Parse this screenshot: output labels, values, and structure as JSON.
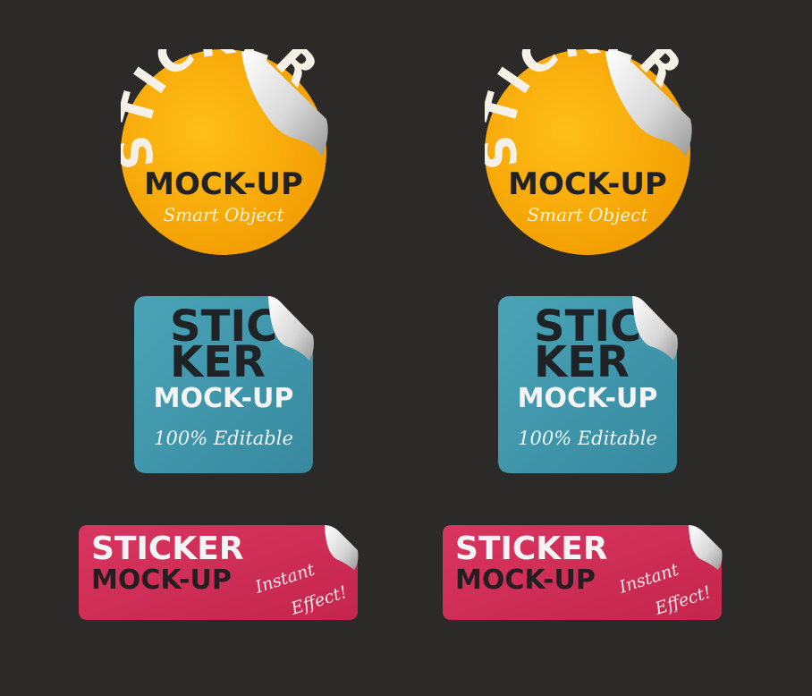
{
  "background": "#2b2a29",
  "colors": {
    "circle_sticker": "#f7a400",
    "square_sticker": "#3f98ad",
    "rect_sticker": "#d12c55",
    "dark_text": "#222222",
    "light_text": "#f4f4f4",
    "curl": "#eaeaea"
  },
  "circle_sticker": {
    "top_text": "STICKER",
    "main_text": "MOCK-UP",
    "script_text": "Smart Object"
  },
  "square_sticker": {
    "line1": "STIC",
    "line2": "KER",
    "main_text": "MOCK-UP",
    "script_text": "100% Editable"
  },
  "rect_sticker": {
    "line1": "STICKER",
    "line2": "MOCK-UP",
    "script_line1": "Instant",
    "script_line2": "Effect!"
  }
}
